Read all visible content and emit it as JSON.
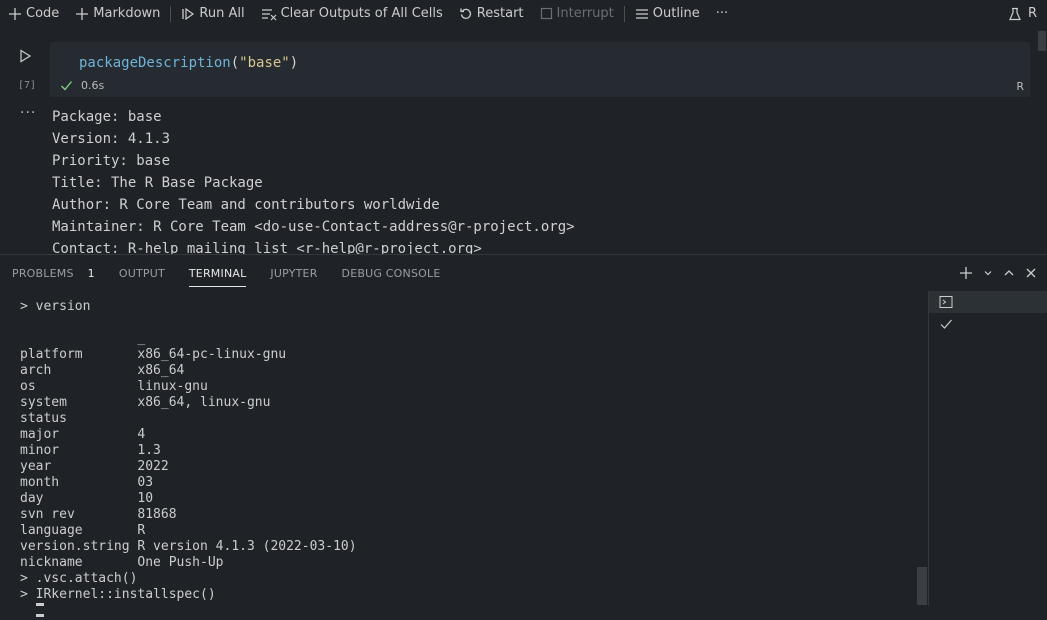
{
  "toolbar": {
    "code_label": "Code",
    "markdown_label": "Markdown",
    "run_all_label": "Run All",
    "clear_outputs_label": "Clear Outputs of All Cells",
    "restart_label": "Restart",
    "interrupt_label": "Interrupt",
    "outline_label": "Outline",
    "more_label": "···",
    "kernel_label": "R"
  },
  "cell": {
    "exec_count": "[7]",
    "code": {
      "fn": "packageDescription",
      "open": "(",
      "arg": "\"base\"",
      "close": ")"
    },
    "duration": "0.6s",
    "language": "R",
    "output_dots": "···",
    "output_lines": [
      "Package: base",
      "Version: 4.1.3",
      "Priority: base",
      "Title: The R Base Package",
      "Author: R Core Team and contributors worldwide",
      "Maintainer: R Core Team <do-use-Contact-address@r-project.org>",
      "Contact: R-help mailing list <r-help@r-project.org>"
    ]
  },
  "panel": {
    "tabs": [
      {
        "label": "PROBLEMS",
        "badge": "1"
      },
      {
        "label": "OUTPUT"
      },
      {
        "label": "TERMINAL"
      },
      {
        "label": "JUPYTER"
      },
      {
        "label": "DEBUG CONSOLE"
      }
    ],
    "terminal_lines": [
      "> version",
      "",
      "               _",
      "platform       x86_64-pc-linux-gnu",
      "arch           x86_64",
      "os             linux-gnu",
      "system         x86_64, linux-gnu",
      "status",
      "major          4",
      "minor          1.3",
      "year           2022",
      "month          03",
      "day            10",
      "svn rev        81868",
      "language       R",
      "version.string R version 4.1.3 (2022-03-10)",
      "nickname       One Push-Up",
      "> .vsc.attach()",
      "> IRkernel::installspec()"
    ],
    "prompt": "> "
  },
  "colors": {
    "background": "#1f2328",
    "cell_editor": "#262b31",
    "function": "#6fb3d8",
    "string": "#d7c78f",
    "success": "#89d185"
  }
}
